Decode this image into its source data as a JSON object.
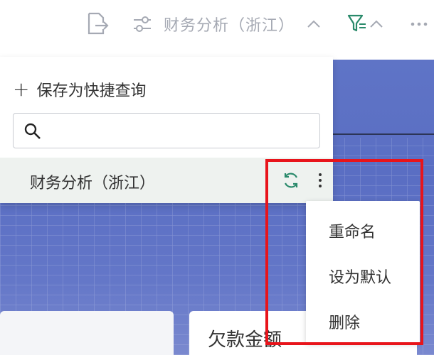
{
  "toolbar": {
    "title": "财务分析（浙江）",
    "icons": [
      "export-icon",
      "sliders-icon",
      "chevron-up-icon",
      "filter-icon",
      "chevron-up-icon",
      "more-horizontal-icon"
    ]
  },
  "panel": {
    "save_label": "保存为快捷查询",
    "search_placeholder": "",
    "queries": [
      {
        "label": "财务分析（浙江）",
        "icons": [
          "refresh-icon",
          "more-vertical-icon"
        ]
      }
    ]
  },
  "menu": {
    "items": [
      "重命名",
      "设为默认",
      "删除"
    ]
  },
  "cards": {
    "right_title": "欠款金额"
  },
  "colors": {
    "accent": "#2a8a6b",
    "highlight": "#e8141b",
    "background_blue": "#5f74c6",
    "muted_text": "#a5a9b3"
  }
}
